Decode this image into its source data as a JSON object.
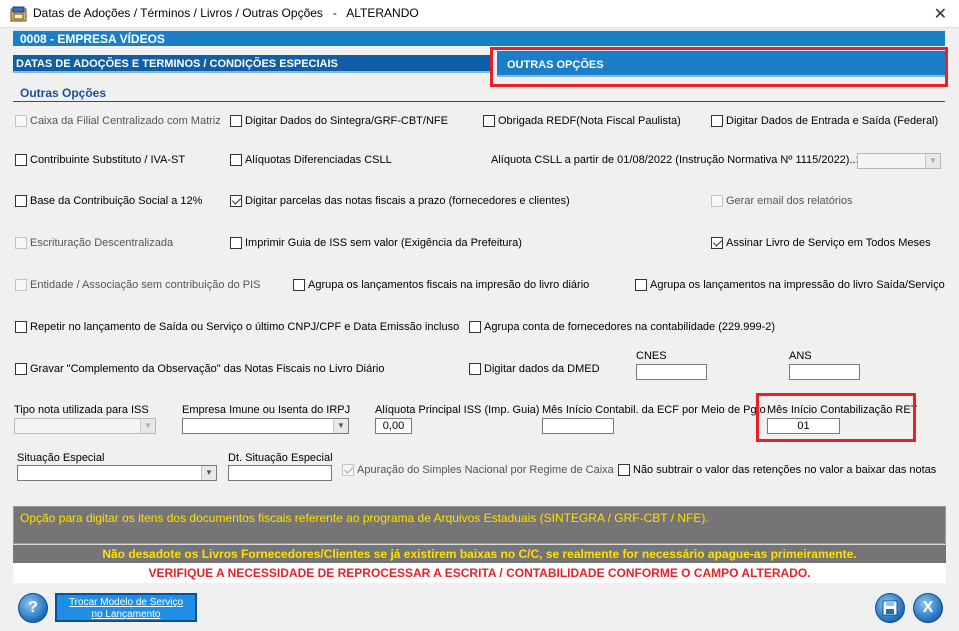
{
  "window": {
    "title": "Datas de Adoções / Términos / Livros / Outras Opções   -   ALTERANDO"
  },
  "company_bar": "0008   -   EMPRESA VÍDEOS",
  "tabs": {
    "dates": "DATAS DE ADOÇÕES E TERMINOS / CONDIÇÕES ESPECIAIS",
    "other": "OUTRAS OPÇÕES"
  },
  "section_title": "Outras Opções",
  "checkboxes": {
    "caixa_filial": "Caixa da Filial Centralizado com Matriz",
    "sintegra": "Digitar Dados do Sintegra/GRF-CBT/NFE",
    "redf": "Obrigada REDF(Nota Fiscal Paulista)",
    "entrada_saida": "Digitar Dados de Entrada e Saída (Federal)",
    "contribuinte_st": "Contribuinte Substituto / IVA-ST",
    "aliquotas_csll": "Alíquotas Diferenciadas CSLL",
    "base_contrib": "Base da Contribuição Social a 12%",
    "parcelas": "Digitar parcelas das notas fiscais a prazo (fornecedores e clientes)",
    "gerar_email": "Gerar email dos relatórios",
    "escrituracao": "Escrituração Descentralizada",
    "guia_iss": "Imprimir Guia de ISS sem valor (Exigência da Prefeitura)",
    "assinar_livro": "Assinar Livro de Serviço em Todos Meses",
    "entidade": "Entidade / Associação sem contribuição do PIS",
    "agrupa_diario": "Agrupa os lançamentos fiscais na impresão do livro diário",
    "agrupa_saida": "Agrupa os lançamentos na impressão do livro Saída/Serviço",
    "repetir": "Repetir no lançamento de Saída ou Serviço o último CNPJ/CPF e Data Emissão incluso",
    "agrupa_conta": "Agrupa conta de fornecedores na contabilidade (229.999-2)",
    "gravar_compl": "Gravar \"Complemento da Observação\" das Notas Fiscais no Livro Diário",
    "dmed": "Digitar dados da DMED",
    "apuracao_simples": "Apuração do Simples Nacional por Regime de Caixa",
    "nao_subtrair": "Não subtrair o valor das retenções no valor a baixar das notas"
  },
  "fields": {
    "aliquota_csll_label": "Alíquota CSLL a partir de 01/08/2022 (Instrução Normativa Nº 1115/2022)..:",
    "cnes_label": "CNES",
    "ans_label": "ANS",
    "tipo_nota_label": "Tipo nota utilizada para ISS",
    "empresa_imune_label": "Empresa Imune ou Isenta do IRPJ",
    "aliquota_iss_label": "Alíquota Principal ISS (Imp. Guia)",
    "aliquota_iss_value": "0,00",
    "mes_ecf_label": "Mês Início Contabil. da ECF por Meio de Pgto",
    "mes_ret_label": "Mês Início Contabilização RET",
    "mes_ret_value": "01",
    "situacao_label": "Situação Especial",
    "dt_situacao_label": "Dt. Situação Especial"
  },
  "info": {
    "line1": "Opção para digitar os itens dos documentos fiscais referente ao programa de Arquivos Estaduais (SINTEGRA / GRF-CBT / NFE).",
    "line2": "Não desadote os Livros Fornecedores/Clientes se já existirem baixas no C/C, se realmente for necessário apague-as primeiramente.",
    "line3": "VERIFIQUE A NECESSIDADE DE REPROCESSAR A ESCRITA / CONTABILIDADE CONFORME O CAMPO ALTERADO."
  },
  "buttons": {
    "help": "?",
    "model_line1": "Trocar Modelo de Serviço",
    "model_line2": "no Lançamento",
    "close": "X"
  },
  "colors": {
    "accent_blue": "#1a7fc6",
    "highlight_red": "#e8202a",
    "info_yellow": "#ffe000"
  }
}
